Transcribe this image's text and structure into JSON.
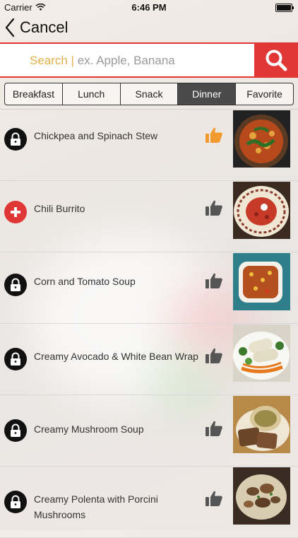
{
  "status_bar": {
    "carrier": "Carrier",
    "time": "6:46 PM"
  },
  "nav": {
    "back_label": "Cancel"
  },
  "search": {
    "prefix": "Search |",
    "placeholder": " ex. Apple, Banana"
  },
  "tabs": [
    {
      "label": "Breakfast",
      "active": false
    },
    {
      "label": "Lunch",
      "active": false
    },
    {
      "label": "Snack",
      "active": false
    },
    {
      "label": "Dinner",
      "active": true
    },
    {
      "label": "Favorite",
      "active": false
    }
  ],
  "recipes": [
    {
      "title": "Chickpea and Spinach Stew",
      "status": "locked",
      "liked": true
    },
    {
      "title": "Chili Burrito",
      "status": "add",
      "liked": false
    },
    {
      "title": "Corn and Tomato Soup",
      "status": "locked",
      "liked": false
    },
    {
      "title": "Creamy Avocado & White Bean Wrap",
      "status": "locked",
      "liked": false
    },
    {
      "title": "Creamy Mushroom Soup",
      "status": "locked",
      "liked": false
    },
    {
      "title": "Creamy Polenta with Porcini Mushrooms",
      "status": "locked",
      "liked": false
    }
  ],
  "colors": {
    "accent_red": "#e03636",
    "liked_orange": "#f39a2e",
    "thumb_gray": "#555555",
    "active_tab": "#4a4a4a",
    "search_prefix": "#e2b04a"
  },
  "icons": [
    "wifi-icon",
    "back-chevron-icon",
    "search-icon",
    "lock-icon",
    "plus-icon",
    "thumbs-up-icon",
    "food-photo"
  ]
}
